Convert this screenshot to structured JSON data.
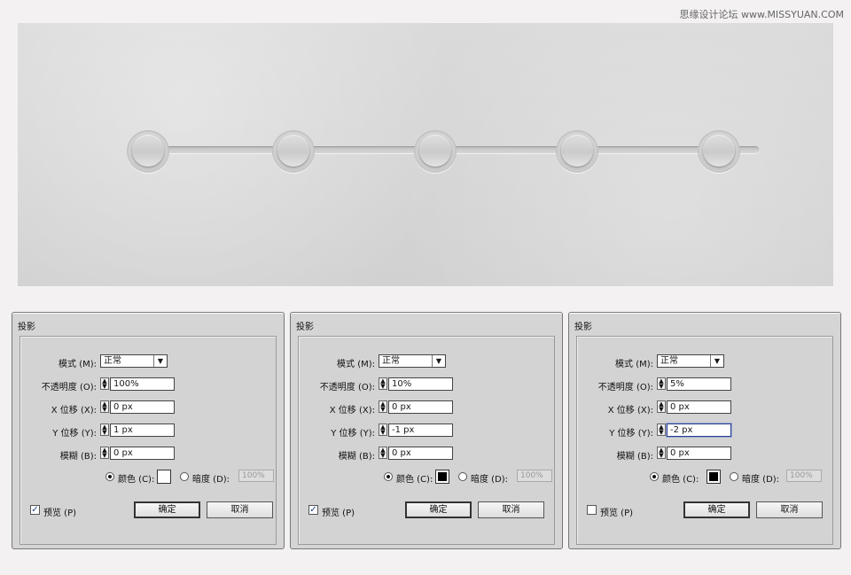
{
  "watermark": "思缘设计论坛 www.MISSYUAN.COM",
  "dialogs": [
    {
      "title": "投影",
      "mode_label": "模式 (M):",
      "mode_value": "正常",
      "opacity_label": "不透明度 (O):",
      "opacity_value": "100%",
      "x_label": "X 位移 (X):",
      "x_value": "0 px",
      "y_label": "Y 位移 (Y):",
      "y_value": "1 px",
      "blur_label": "模糊 (B):",
      "blur_value": "0 px",
      "color_label": "颜色 (C):",
      "color_swatch": "#ffffff",
      "darkness_label": "暗度 (D):",
      "darkness_value": "100%",
      "preview_label": "预览 (P)",
      "preview_checked": true,
      "ok_label": "确定",
      "cancel_label": "取消"
    },
    {
      "title": "投影",
      "mode_label": "模式 (M):",
      "mode_value": "正常",
      "opacity_label": "不透明度 (O):",
      "opacity_value": "10%",
      "x_label": "X 位移 (X):",
      "x_value": "0 px",
      "y_label": "Y 位移 (Y):",
      "y_value": "-1 px",
      "blur_label": "模糊 (B):",
      "blur_value": "0 px",
      "color_label": "颜色 (C):",
      "color_swatch": "#000000",
      "darkness_label": "暗度 (D):",
      "darkness_value": "100%",
      "preview_label": "预览 (P)",
      "preview_checked": true,
      "ok_label": "确定",
      "cancel_label": "取消"
    },
    {
      "title": "投影",
      "mode_label": "模式 (M):",
      "mode_value": "正常",
      "opacity_label": "不透明度 (O):",
      "opacity_value": "5%",
      "x_label": "X 位移 (X):",
      "x_value": "0 px",
      "y_label": "Y 位移 (Y):",
      "y_value": "-2 px",
      "blur_label": "模糊 (B):",
      "blur_value": "0 px",
      "color_label": "颜色 (C):",
      "color_swatch": "#000000",
      "darkness_label": "暗度 (D):",
      "darkness_value": "100%",
      "preview_label": "预览 (P)",
      "preview_checked": false,
      "ok_label": "确定",
      "cancel_label": "取消"
    }
  ],
  "colors": {
    "canvas_bg": "#d6d6d6",
    "dialog_bg": "#d5d5d5",
    "focus_border": "#2b3f88"
  }
}
